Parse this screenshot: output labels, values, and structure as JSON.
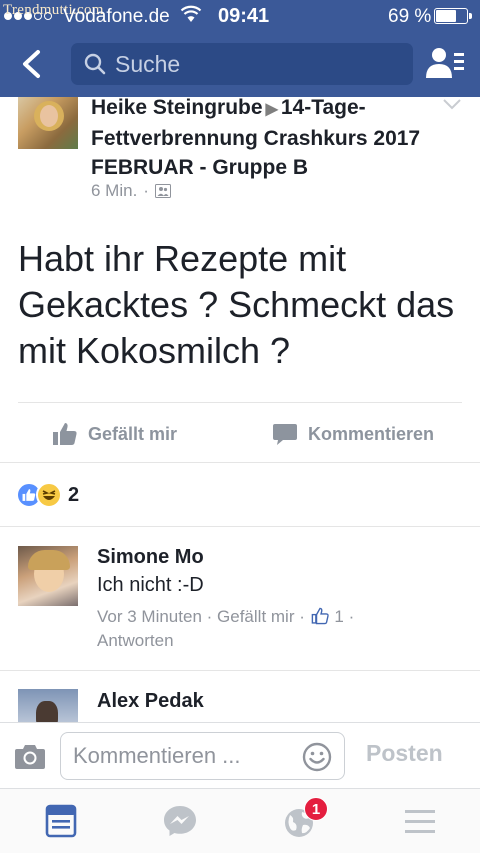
{
  "status_bar": {
    "watermark": "Trendmutti.com",
    "carrier": "Vodafone.de",
    "time": "09:41",
    "battery_percent_label": "69 %",
    "battery_level": 0.69
  },
  "nav": {
    "search_placeholder": "Suche"
  },
  "post": {
    "author": "Heike Steingrube",
    "group": "14-Tage-Fettverbrennung Crashkurs 2017 FEBRUAR - Gruppe B",
    "time": "6 Min.",
    "separator": "·",
    "text": "Habt ihr Rezepte mit Gekacktes ? Schmeckt das mit Kokosmilch ?"
  },
  "actions": {
    "like_label": "Gefällt mir",
    "comment_label": "Kommentieren"
  },
  "reactions": {
    "count": "2"
  },
  "comments": [
    {
      "name": "Simone Mo",
      "text": "Ich nicht :-D",
      "time": "Vor 3 Minuten",
      "like_label": "Gefällt mir",
      "like_count": "1",
      "reply_label": "Antworten"
    },
    {
      "name": "Alex Pedak"
    }
  ],
  "composer": {
    "placeholder": "Kommentieren ...",
    "post_label": "Posten"
  },
  "tabbar": {
    "notifications_badge": "1"
  },
  "colors": {
    "brand": "#3b5998",
    "link_grey": "#90949c",
    "badge": "#e41e3f",
    "like_blue": "#5890ff"
  }
}
